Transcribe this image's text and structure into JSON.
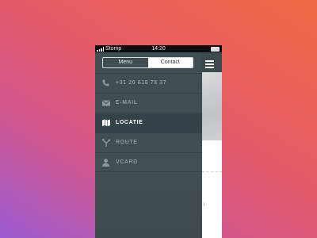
{
  "status_bar": {
    "carrier": "Stomp",
    "time": "14:20"
  },
  "segmented": {
    "items": [
      {
        "label": "Menu",
        "active": false
      },
      {
        "label": "Contact",
        "active": true
      }
    ]
  },
  "menu": {
    "items": [
      {
        "label": "+31 20 618 78 37",
        "icon": "phone-icon",
        "active": false
      },
      {
        "label": "E-MAIL",
        "icon": "envelope-icon",
        "active": false
      },
      {
        "label": "LOCATIE",
        "icon": "map-icon",
        "active": true
      },
      {
        "label": "ROUTE",
        "icon": "route-icon",
        "active": false
      },
      {
        "label": "VCARD",
        "icon": "person-icon",
        "active": false
      }
    ]
  },
  "content": {
    "snippet": "L"
  },
  "colors": {
    "panel": "#414e52",
    "active_row": "#34424a",
    "inactive_text": "#8b999d",
    "active_text": "#ffffff"
  }
}
